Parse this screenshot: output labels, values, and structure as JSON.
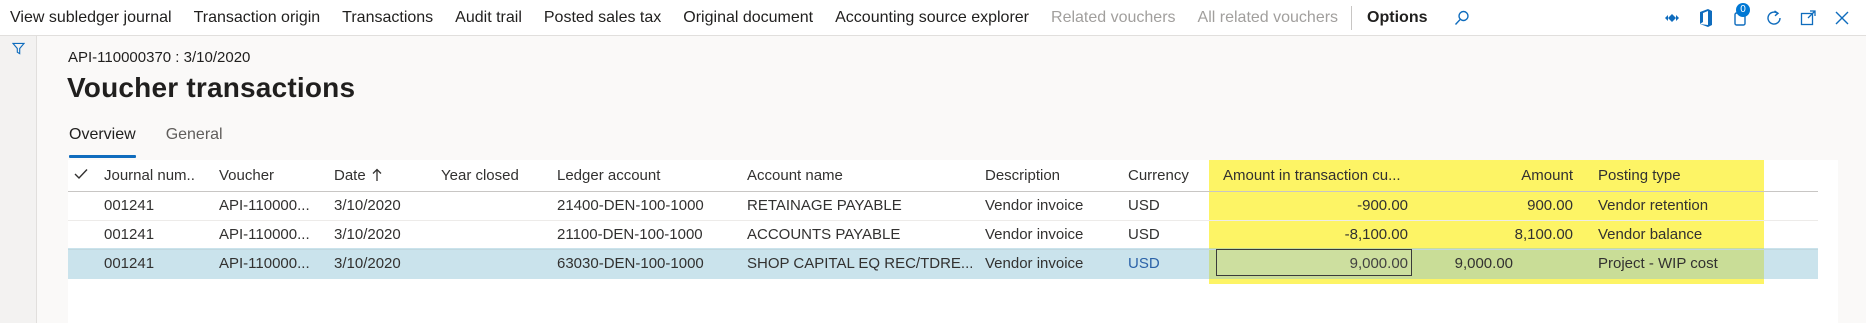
{
  "actions": [
    {
      "label": "View subledger journal",
      "disabled": false
    },
    {
      "label": "Transaction origin",
      "disabled": false
    },
    {
      "label": "Transactions",
      "disabled": false
    },
    {
      "label": "Audit trail",
      "disabled": false
    },
    {
      "label": "Posted sales tax",
      "disabled": false
    },
    {
      "label": "Original document",
      "disabled": false
    },
    {
      "label": "Accounting source explorer",
      "disabled": false
    },
    {
      "label": "Related vouchers",
      "disabled": true
    },
    {
      "label": "All related vouchers",
      "disabled": true
    }
  ],
  "options_label": "Options",
  "notification_count": "0",
  "header": {
    "breadcrumb": "API-110000370 : 3/10/2020",
    "title": "Voucher transactions"
  },
  "tabs": [
    "Overview",
    "General"
  ],
  "grid": {
    "columns": [
      "Journal num...",
      "Voucher",
      "Date",
      "Year closed",
      "Ledger account",
      "Account name",
      "Description",
      "Currency",
      "Amount in transaction cu...",
      "Amount",
      "Posting type"
    ],
    "rows": [
      {
        "journal": "001241",
        "voucher": "API-110000...",
        "date": "3/10/2020",
        "year_closed": "",
        "ledger": "21400-DEN-100-1000",
        "account_name": "RETAINAGE PAYABLE",
        "description": "Vendor invoice",
        "currency": "USD",
        "amount_tx": "-900.00",
        "amount": "900.00",
        "posting_type": "Vendor retention"
      },
      {
        "journal": "001241",
        "voucher": "API-110000...",
        "date": "3/10/2020",
        "year_closed": "",
        "ledger": "21100-DEN-100-1000",
        "account_name": "ACCOUNTS PAYABLE",
        "description": "Vendor invoice",
        "currency": "USD",
        "amount_tx": "-8,100.00",
        "amount": "8,100.00",
        "posting_type": "Vendor balance"
      },
      {
        "journal": "001241",
        "voucher": "API-110000...",
        "date": "3/10/2020",
        "year_closed": "",
        "ledger": "63030-DEN-100-1000",
        "account_name": "SHOP CAPITAL EQ REC/TDRE...",
        "description": "Vendor invoice",
        "currency": "USD",
        "amount_tx": "9,000.00",
        "amount": "9,000.00",
        "posting_type": "Project - WIP cost"
      }
    ]
  },
  "colors": {
    "highlight": "#fdf24a",
    "selected_row": "#c9e2ea",
    "accent": "#0f6cbd"
  }
}
